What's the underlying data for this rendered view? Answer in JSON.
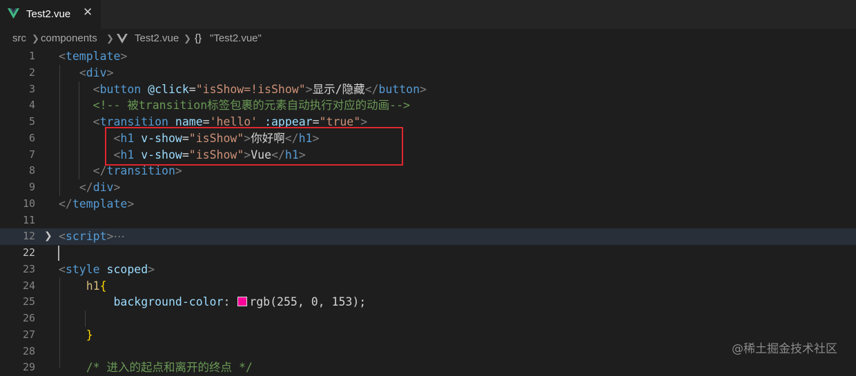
{
  "tab": {
    "title": "Test2.vue",
    "close": "✕"
  },
  "breadcrumb": {
    "src": "src",
    "components": "components",
    "file": "Test2.vue",
    "symbol_icon": "{}",
    "symbol": "\"Test2.vue\""
  },
  "lines": {
    "1": {
      "num": "1"
    },
    "2": {
      "num": "2"
    },
    "3": {
      "num": "3"
    },
    "4": {
      "num": "4"
    },
    "5": {
      "num": "5"
    },
    "6": {
      "num": "6"
    },
    "7": {
      "num": "7"
    },
    "8": {
      "num": "8"
    },
    "9": {
      "num": "9"
    },
    "10": {
      "num": "10"
    },
    "11": {
      "num": "11"
    },
    "12": {
      "num": "12"
    },
    "22": {
      "num": "22"
    },
    "23": {
      "num": "23"
    },
    "24": {
      "num": "24"
    },
    "25": {
      "num": "25"
    },
    "26": {
      "num": "26"
    },
    "27": {
      "num": "27"
    },
    "28": {
      "num": "28"
    },
    "29": {
      "num": "29"
    }
  },
  "code": {
    "l3_label": "显示/隐藏",
    "l4_comment": "<!-- 被transition标签包裹的元素自动执行对应的动画-->",
    "l6_text": "你好啊",
    "l7_text": "Vue",
    "l12_fold": "⋯",
    "l25_color": "rgb(255, 0, 153)",
    "l29_comment": "/* 进入的起点和离开的终点 */"
  },
  "watermark": "@稀土掘金技术社区"
}
